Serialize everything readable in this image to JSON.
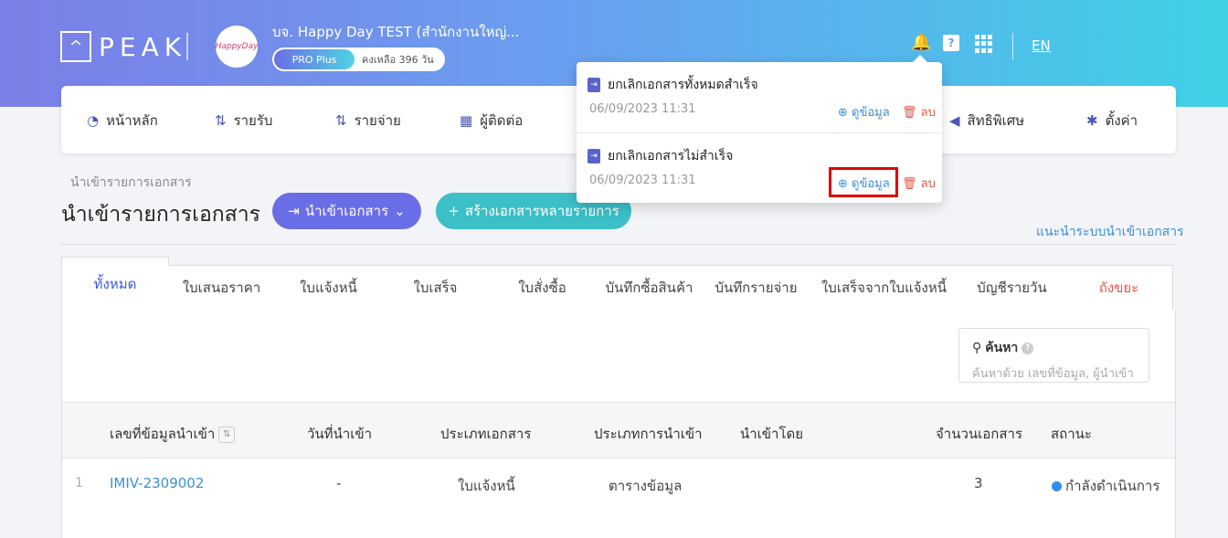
{
  "header": {
    "logo_text": "PEAK",
    "logo_mark": "^",
    "company_name": "บจ. Happy Day TEST (สำนักงานใหญ่...",
    "plan_badge": "PRO Plus",
    "plan_remaining": "คงเหลือ 396 วัน",
    "lang": "EN",
    "icons": [
      "bell-icon",
      "help-icon",
      "apps-grid-icon"
    ]
  },
  "nav": {
    "items": [
      {
        "label": "หน้าหลัก",
        "icon": "dashboard-icon"
      },
      {
        "label": "รายรับ",
        "icon": "income-icon"
      },
      {
        "label": "รายจ่าย",
        "icon": "expense-icon"
      },
      {
        "label": "ผู้ติดต่อ",
        "icon": "contacts-icon"
      },
      {
        "label": "สิทธิพิเศษ",
        "icon": "megaphone-icon"
      },
      {
        "label": "ตั้งค่า",
        "icon": "gear-icon"
      }
    ]
  },
  "page": {
    "breadcrumb": "นำเข้ารายการเอกสาร",
    "title": "นำเข้ารายการเอกสาร",
    "import_button": "นำเข้าเอกสาร",
    "create_button": "สร้างเอกสารหลายรายการ",
    "guide_link": "แนะนำระบบนำเข้าเอกสาร"
  },
  "tabs": [
    "ทั้งหมด",
    "ใบเสนอราคา",
    "ใบแจ้งหนี้",
    "ใบเสร็จ",
    "ใบสั่งซื้อ",
    "บันทึกซื้อสินค้า",
    "บันทึกรายจ่าย",
    "ใบเสร็จจากใบแจ้งหนี้",
    "บัญชีรายวัน",
    "ถังขยะ"
  ],
  "search": {
    "label": "ค้นหา",
    "placeholder": "ค้นหาด้วย เลขที่ข้อมูล, ผู้นำเข้า"
  },
  "table": {
    "columns": [
      "เลขที่ข้อมูลนำเข้า",
      "วันที่นำเข้า",
      "ประเภทเอกสาร",
      "ประเภทการนำเข้า",
      "นำเข้าโดย",
      "จำนวนเอกสาร",
      "สถานะ"
    ],
    "rows": [
      {
        "num": "1",
        "id": "IMIV-2309002",
        "date": "-",
        "doc_type": "ใบแจ้งหนี้",
        "import_type": "ตารางข้อมูล",
        "by": "",
        "count": "3",
        "status": "กำลังดำเนินการ"
      }
    ]
  },
  "notifications": [
    {
      "title": "ยกเลิกเอกสารทั้งหมดสำเร็จ",
      "time": "06/09/2023 11:31",
      "view": "ดูข้อมูล",
      "delete": "ลบ"
    },
    {
      "title": "ยกเลิกเอกสารไม่สำเร็จ",
      "time": "06/09/2023 11:31",
      "view": "ดูข้อมูล",
      "delete": "ลบ"
    }
  ],
  "colors": {
    "accent": "#6a6ee6",
    "teal": "#3cbfc6",
    "link": "#3a8fd6",
    "danger": "#e3564a",
    "highlight": "#e30000"
  }
}
